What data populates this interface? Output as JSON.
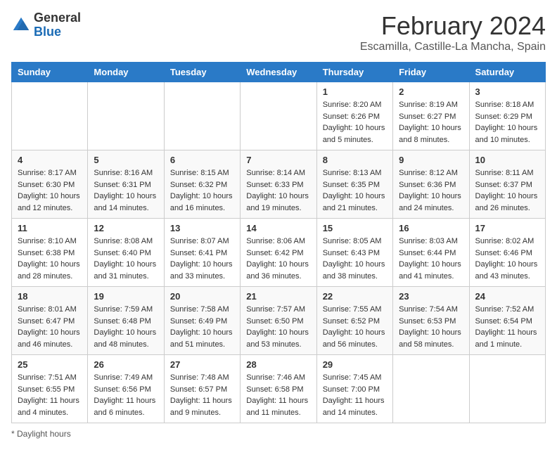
{
  "header": {
    "logo_line1": "General",
    "logo_line2": "Blue",
    "main_title": "February 2024",
    "sub_title": "Escamilla, Castille-La Mancha, Spain"
  },
  "days_of_week": [
    "Sunday",
    "Monday",
    "Tuesday",
    "Wednesday",
    "Thursday",
    "Friday",
    "Saturday"
  ],
  "weeks": [
    [
      {
        "day": "",
        "info": ""
      },
      {
        "day": "",
        "info": ""
      },
      {
        "day": "",
        "info": ""
      },
      {
        "day": "",
        "info": ""
      },
      {
        "day": "1",
        "info": "Sunrise: 8:20 AM\nSunset: 6:26 PM\nDaylight: 10 hours and 5 minutes."
      },
      {
        "day": "2",
        "info": "Sunrise: 8:19 AM\nSunset: 6:27 PM\nDaylight: 10 hours and 8 minutes."
      },
      {
        "day": "3",
        "info": "Sunrise: 8:18 AM\nSunset: 6:29 PM\nDaylight: 10 hours and 10 minutes."
      }
    ],
    [
      {
        "day": "4",
        "info": "Sunrise: 8:17 AM\nSunset: 6:30 PM\nDaylight: 10 hours and 12 minutes."
      },
      {
        "day": "5",
        "info": "Sunrise: 8:16 AM\nSunset: 6:31 PM\nDaylight: 10 hours and 14 minutes."
      },
      {
        "day": "6",
        "info": "Sunrise: 8:15 AM\nSunset: 6:32 PM\nDaylight: 10 hours and 16 minutes."
      },
      {
        "day": "7",
        "info": "Sunrise: 8:14 AM\nSunset: 6:33 PM\nDaylight: 10 hours and 19 minutes."
      },
      {
        "day": "8",
        "info": "Sunrise: 8:13 AM\nSunset: 6:35 PM\nDaylight: 10 hours and 21 minutes."
      },
      {
        "day": "9",
        "info": "Sunrise: 8:12 AM\nSunset: 6:36 PM\nDaylight: 10 hours and 24 minutes."
      },
      {
        "day": "10",
        "info": "Sunrise: 8:11 AM\nSunset: 6:37 PM\nDaylight: 10 hours and 26 minutes."
      }
    ],
    [
      {
        "day": "11",
        "info": "Sunrise: 8:10 AM\nSunset: 6:38 PM\nDaylight: 10 hours and 28 minutes."
      },
      {
        "day": "12",
        "info": "Sunrise: 8:08 AM\nSunset: 6:40 PM\nDaylight: 10 hours and 31 minutes."
      },
      {
        "day": "13",
        "info": "Sunrise: 8:07 AM\nSunset: 6:41 PM\nDaylight: 10 hours and 33 minutes."
      },
      {
        "day": "14",
        "info": "Sunrise: 8:06 AM\nSunset: 6:42 PM\nDaylight: 10 hours and 36 minutes."
      },
      {
        "day": "15",
        "info": "Sunrise: 8:05 AM\nSunset: 6:43 PM\nDaylight: 10 hours and 38 minutes."
      },
      {
        "day": "16",
        "info": "Sunrise: 8:03 AM\nSunset: 6:44 PM\nDaylight: 10 hours and 41 minutes."
      },
      {
        "day": "17",
        "info": "Sunrise: 8:02 AM\nSunset: 6:46 PM\nDaylight: 10 hours and 43 minutes."
      }
    ],
    [
      {
        "day": "18",
        "info": "Sunrise: 8:01 AM\nSunset: 6:47 PM\nDaylight: 10 hours and 46 minutes."
      },
      {
        "day": "19",
        "info": "Sunrise: 7:59 AM\nSunset: 6:48 PM\nDaylight: 10 hours and 48 minutes."
      },
      {
        "day": "20",
        "info": "Sunrise: 7:58 AM\nSunset: 6:49 PM\nDaylight: 10 hours and 51 minutes."
      },
      {
        "day": "21",
        "info": "Sunrise: 7:57 AM\nSunset: 6:50 PM\nDaylight: 10 hours and 53 minutes."
      },
      {
        "day": "22",
        "info": "Sunrise: 7:55 AM\nSunset: 6:52 PM\nDaylight: 10 hours and 56 minutes."
      },
      {
        "day": "23",
        "info": "Sunrise: 7:54 AM\nSunset: 6:53 PM\nDaylight: 10 hours and 58 minutes."
      },
      {
        "day": "24",
        "info": "Sunrise: 7:52 AM\nSunset: 6:54 PM\nDaylight: 11 hours and 1 minute."
      }
    ],
    [
      {
        "day": "25",
        "info": "Sunrise: 7:51 AM\nSunset: 6:55 PM\nDaylight: 11 hours and 4 minutes."
      },
      {
        "day": "26",
        "info": "Sunrise: 7:49 AM\nSunset: 6:56 PM\nDaylight: 11 hours and 6 minutes."
      },
      {
        "day": "27",
        "info": "Sunrise: 7:48 AM\nSunset: 6:57 PM\nDaylight: 11 hours and 9 minutes."
      },
      {
        "day": "28",
        "info": "Sunrise: 7:46 AM\nSunset: 6:58 PM\nDaylight: 11 hours and 11 minutes."
      },
      {
        "day": "29",
        "info": "Sunrise: 7:45 AM\nSunset: 7:00 PM\nDaylight: 11 hours and 14 minutes."
      },
      {
        "day": "",
        "info": ""
      },
      {
        "day": "",
        "info": ""
      }
    ]
  ],
  "footer": {
    "note": "Daylight hours"
  }
}
